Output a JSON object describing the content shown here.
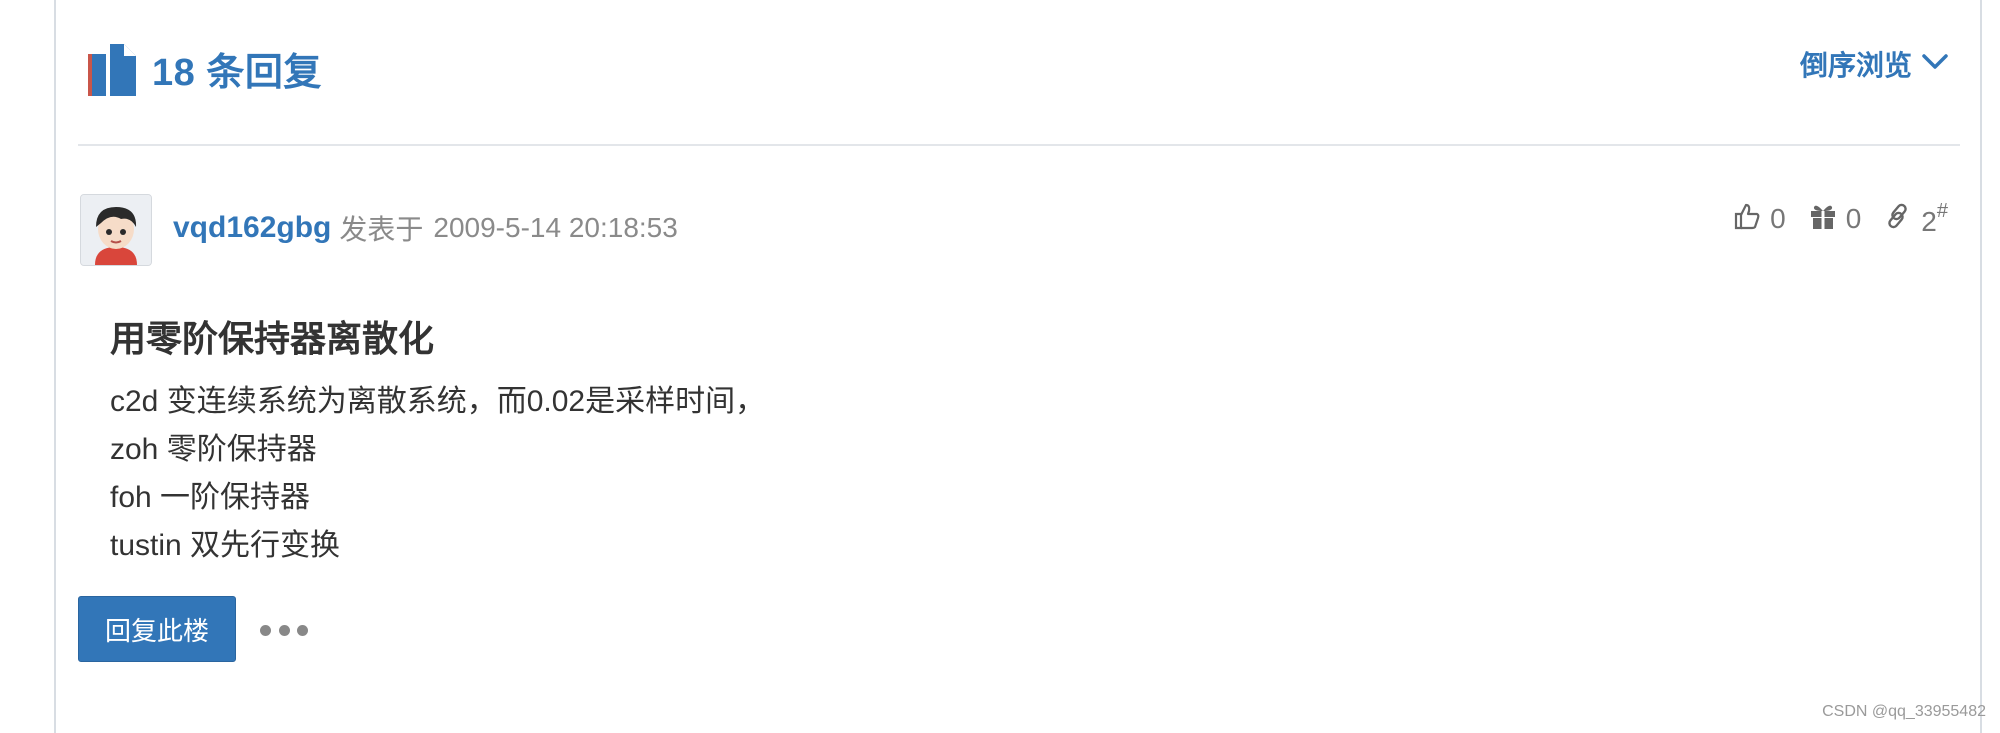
{
  "header": {
    "replies_count_label": "18 条回复",
    "sort_label": "倒序浏览"
  },
  "post": {
    "author": "vqd162gbg",
    "posted_label": "发表于",
    "timestamp": "2009-5-14 20:18:53",
    "likes": "0",
    "gifts": "0",
    "floor": "2",
    "floor_mark": "#",
    "title": "用零阶保持器离散化",
    "lines": [
      "c2d 变连续系统为离散系统，而0.02是采样时间，",
      "zoh 零阶保持器",
      "foh 一阶保持器",
      "tustin 双先行变换"
    ]
  },
  "actions": {
    "reply_label": "回复此楼"
  },
  "watermark": "CSDN @qq_33955482",
  "icons": {
    "replies": "replies-icon",
    "sort": "chevron-down-icon",
    "like": "thumbs-up-icon",
    "gift": "gift-icon",
    "link": "link-icon",
    "more": "more-icon"
  },
  "colors": {
    "accent": "#3276b8",
    "text": "#333333",
    "muted": "#8a8a8a"
  }
}
